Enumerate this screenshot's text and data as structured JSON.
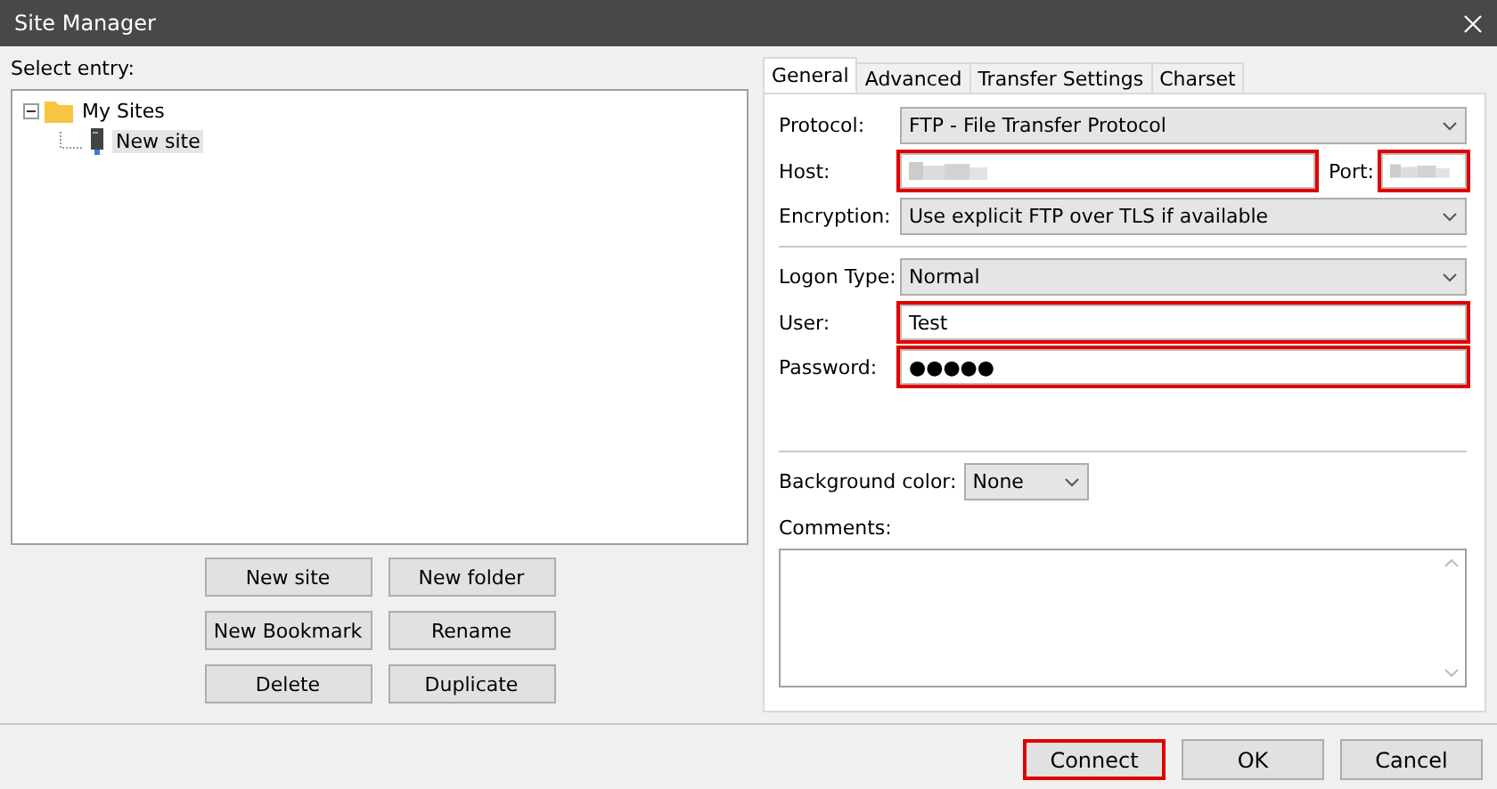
{
  "window": {
    "title": "Site Manager"
  },
  "entry_label": "Select entry:",
  "tree": [
    {
      "label": "My Sites",
      "kind": "folder",
      "expanded": true,
      "selected": false,
      "children": [
        {
          "label": "New site",
          "kind": "site",
          "selected": true
        }
      ]
    }
  ],
  "entry_buttons": [
    "New site",
    "New folder",
    "New Bookmark",
    "Rename",
    "Delete",
    "Duplicate"
  ],
  "tabs": [
    {
      "label": "General",
      "selected": true
    },
    {
      "label": "Advanced",
      "selected": false
    },
    {
      "label": "Transfer Settings",
      "selected": false
    },
    {
      "label": "Charset",
      "selected": false
    }
  ],
  "general": {
    "protocol": {
      "label": "Protocol:",
      "value": "FTP - File Transfer Protocol"
    },
    "host": {
      "label": "Host:",
      "redacted": true,
      "highlighted": true
    },
    "port": {
      "label": "Port:",
      "redacted": true,
      "highlighted": true
    },
    "encryption": {
      "label": "Encryption:",
      "value": "Use explicit FTP over TLS if available"
    },
    "logon_type": {
      "label": "Logon Type:",
      "value": "Normal"
    },
    "user": {
      "label": "User:",
      "value": "Test",
      "highlighted": true
    },
    "password": {
      "label": "Password:",
      "value": "●●●●●",
      "highlighted": true
    },
    "background_color": {
      "label": "Background color:",
      "value": "None"
    },
    "comments": {
      "label": "Comments:"
    }
  },
  "dialog_buttons": [
    {
      "label": "Connect",
      "highlighted": true
    },
    {
      "label": "OK",
      "highlighted": false
    },
    {
      "label": "Cancel",
      "highlighted": false
    }
  ]
}
